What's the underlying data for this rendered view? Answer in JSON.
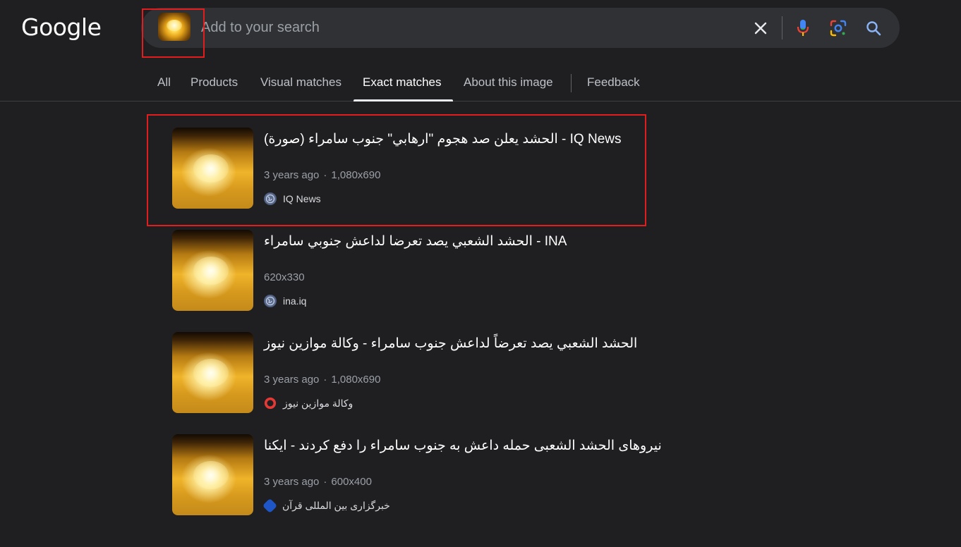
{
  "header": {
    "logo_text": "Google",
    "search": {
      "placeholder": "Add to your search",
      "value": ""
    }
  },
  "tabs": [
    {
      "label": "All",
      "active": false
    },
    {
      "label": "Products",
      "active": false
    },
    {
      "label": "Visual matches",
      "active": false
    },
    {
      "label": "Exact matches",
      "active": true
    },
    {
      "label": "About this image",
      "active": false
    },
    {
      "label": "Feedback",
      "active": false
    }
  ],
  "results": [
    {
      "title": "الحشد يعلن صد هجوم \"ارهابي\" جنوب سامراء (صورة) - IQ News",
      "age": "3 years ago",
      "dimensions": "1,080x690",
      "source": "IQ News",
      "favicon": "globe-icon"
    },
    {
      "title": "الحشد الشعبي يصد تعرضا لداعش جنوبي سامراء - INA",
      "age": "",
      "dimensions": "620x330",
      "source": "ina.iq",
      "favicon": "globe-icon"
    },
    {
      "title": "الحشد الشعبي يصد تعرضاً لداعش جنوب سامراء - وكالة موازين نيوز",
      "age": "3 years ago",
      "dimensions": "1,080x690",
      "source": "وكالة موازين نيوز",
      "favicon": "ring-icon"
    },
    {
      "title": "نیروهای الحشد الشعبی حمله داعش به جنوب سامراء را دفع کردند - ایکنا",
      "age": "3 years ago",
      "dimensions": "600x400",
      "source": "خبرگزاری بین المللی قرآن",
      "favicon": "quran-news-icon"
    }
  ],
  "colors": {
    "background": "#1f1f22",
    "searchbar": "#303134",
    "highlight": "#e11d1d"
  }
}
